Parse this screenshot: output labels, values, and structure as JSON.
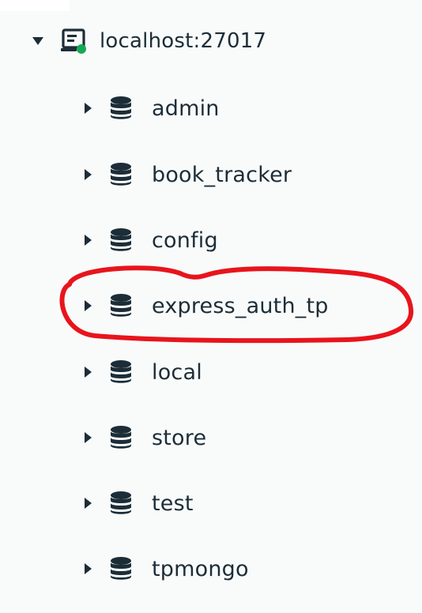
{
  "connection": {
    "label": "localhost:27017",
    "expanded": true,
    "status_color": "#13aa52"
  },
  "databases": [
    {
      "name": "admin"
    },
    {
      "name": "book_tracker"
    },
    {
      "name": "config"
    },
    {
      "name": "express_auth_tp",
      "annotated": true
    },
    {
      "name": "local"
    },
    {
      "name": "store"
    },
    {
      "name": "test"
    },
    {
      "name": "tpmongo"
    }
  ],
  "colors": {
    "text": "#1c2d38",
    "icon": "#1c2d38",
    "annotation": "#e8141c",
    "background": "#f9fbfa"
  },
  "icons": {
    "expand": "caret-down-icon",
    "collapse": "caret-right-icon",
    "server": "server-icon",
    "database": "database-icon"
  }
}
